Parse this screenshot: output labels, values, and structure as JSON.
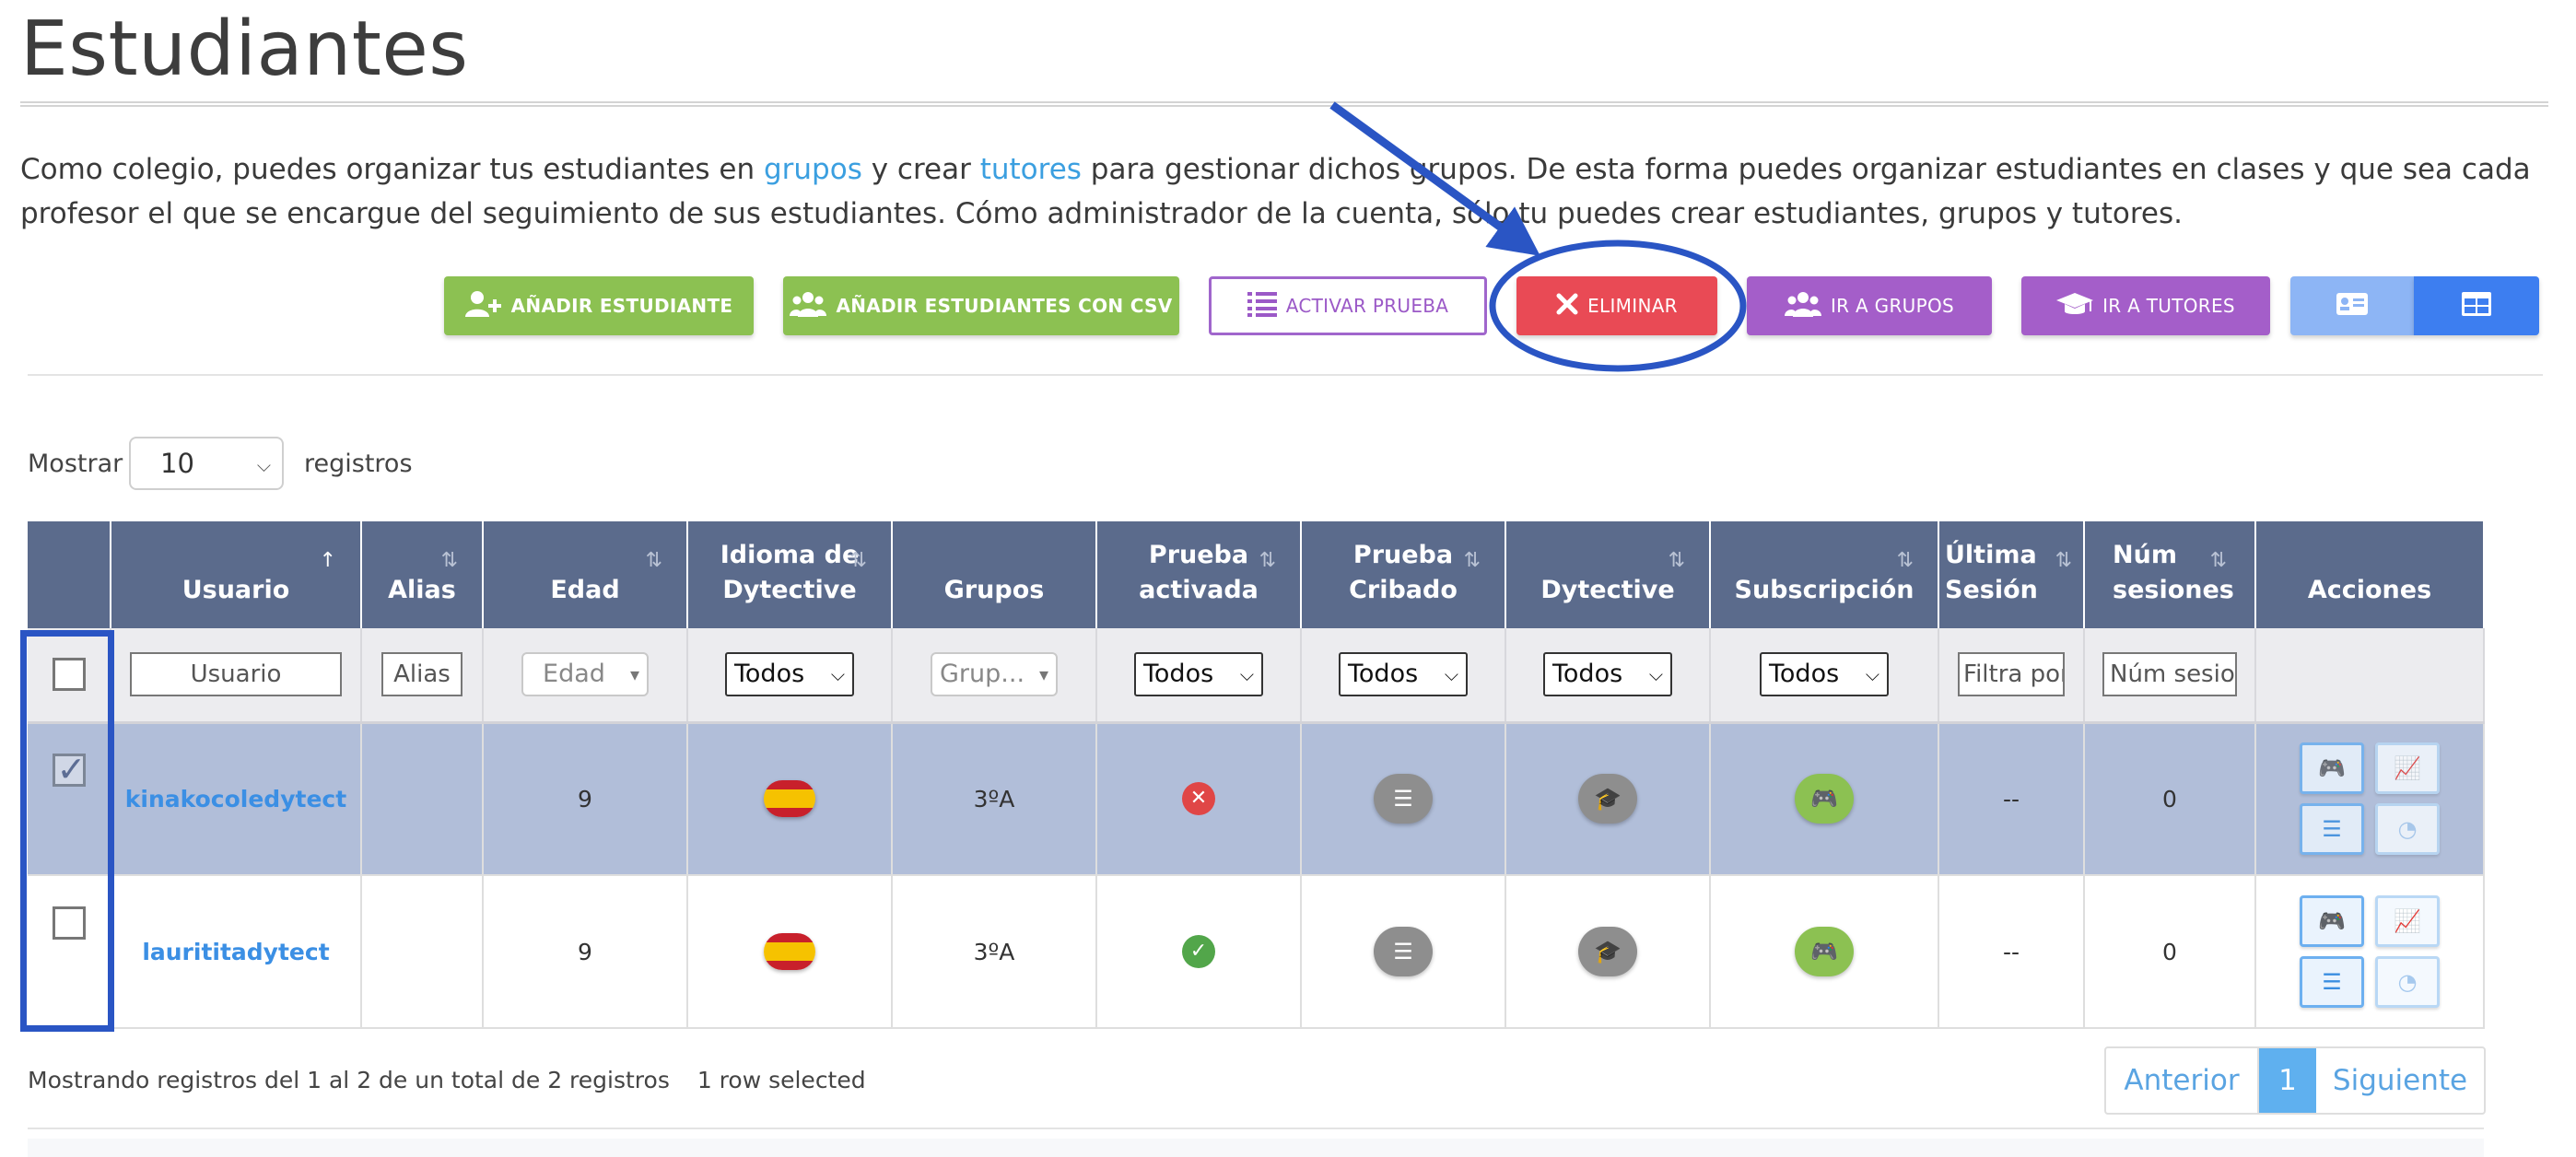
{
  "page": {
    "title": "Estudiantes",
    "intro": {
      "part1": "Como colegio, puedes organizar tus estudiantes en ",
      "link_groups": "grupos",
      "part2": " y crear ",
      "link_tutors": "tutores",
      "part3": " para gestionar dichos grupos. De esta forma puedes organizar estudiantes en clases y que sea cada profesor el que se encargue del seguimiento de sus estudiantes. Cómo administrador de la cuenta, sólo tu puedes crear estudiantes, grupos y tutores."
    }
  },
  "toolbar": {
    "add_student": "AÑADIR ESTUDIANTE",
    "add_csv": "AÑADIR ESTUDIANTES CON CSV",
    "activate_test": "ACTIVAR PRUEBA",
    "delete": "ELIMINAR",
    "go_groups": "IR A GRUPOS",
    "go_tutors": "IR A TUTORES"
  },
  "length_menu": {
    "show_label": "Mostrar",
    "value": "10",
    "records_label": "registros"
  },
  "table": {
    "headers": [
      "",
      "Usuario",
      "Alias",
      "Edad",
      "Idioma de Dytective",
      "Grupos",
      "Prueba activada",
      "Prueba Cribado",
      "Dytective",
      "Subscripción",
      "Última Sesión",
      "Núm sesiones",
      "Acciones"
    ],
    "filters": {
      "usuario_placeholder": "Usuario",
      "alias_placeholder": "Alias",
      "edad_placeholder": "Edad",
      "idioma": "Todos",
      "grupos_placeholder": "Grup...",
      "prueba_activada": "Todos",
      "prueba_cribado": "Todos",
      "dytective": "Todos",
      "subscripcion": "Todos",
      "ultima_placeholder": "Filtra por",
      "num_placeholder": "Núm sesiones"
    },
    "rows": [
      {
        "selected": true,
        "usuario": "kinakocoledytect",
        "alias": "",
        "edad": "9",
        "grupos": "3ºA",
        "prueba_activada": "no",
        "ultima_sesion": "--",
        "num_sesiones": "0"
      },
      {
        "selected": false,
        "usuario": "laurititadytect",
        "alias": "",
        "edad": "9",
        "grupos": "3ºA",
        "prueba_activada": "yes",
        "ultima_sesion": "--",
        "num_sesiones": "0"
      }
    ]
  },
  "footer": {
    "info": "Mostrando registros del 1 al 2 de un total de 2 registros",
    "selected_info": "1 row selected",
    "prev": "Anterior",
    "page": "1",
    "next": "Siguiente"
  },
  "colors": {
    "header_bg": "#5b6b8c",
    "selected_row": "#b1bed9",
    "green": "#8cc152",
    "red": "#e94a55",
    "purple": "#a45ec9",
    "link": "#3b8fe4",
    "annotation": "#2a55c4"
  },
  "icons": {
    "add_student": "user-plus-icon",
    "add_csv": "users-icon",
    "activate_test": "list-icon",
    "delete": "x-icon",
    "go_groups": "users-icon",
    "go_tutors": "graduation-cap-icon",
    "view_cards": "id-card-icon",
    "view_table": "table-icon"
  }
}
